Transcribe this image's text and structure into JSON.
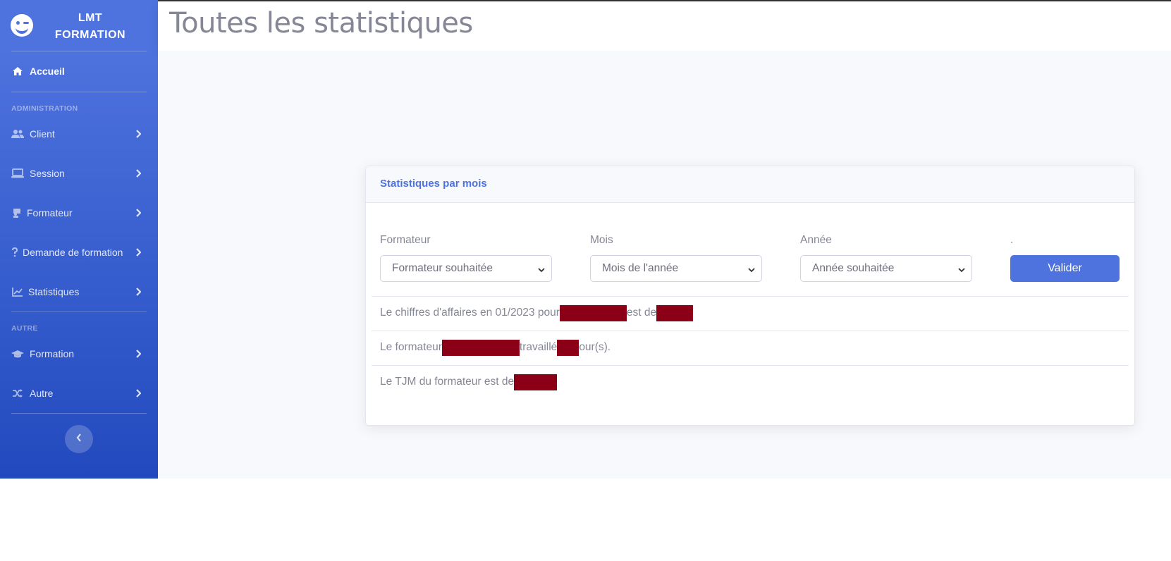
{
  "brand": {
    "line1": "LMT",
    "line2": "FORMATION",
    "logo_icon": "wink-smile-icon"
  },
  "sidebar": {
    "home": {
      "label": "Accueil",
      "icon": "home-icon"
    },
    "section_admin": "ADMINISTRATION",
    "admin_items": [
      {
        "label": "Client",
        "icon": "users-icon"
      },
      {
        "label": "Session",
        "icon": "laptop-icon"
      },
      {
        "label": "Formateur",
        "icon": "chalkboard-teacher-icon"
      },
      {
        "label": "Demande de formation",
        "icon": "question-icon"
      },
      {
        "label": "Statistiques",
        "icon": "chart-line-icon"
      }
    ],
    "section_other": "AUTRE",
    "other_items": [
      {
        "label": "Formation",
        "icon": "graduation-cap-icon"
      },
      {
        "label": "Autre",
        "icon": "random-icon"
      }
    ],
    "toggle_icon": "chevron-left-icon"
  },
  "header": {
    "title": "Toutes les statistiques"
  },
  "card": {
    "title": "Statistiques par mois",
    "fields": {
      "formateur_label": "Formateur",
      "formateur_value": "Formateur souhaitée",
      "mois_label": "Mois",
      "mois_value": "Mois de l'année",
      "annee_label": "Année",
      "annee_value": "Année souhaitée",
      "submit_label": ".",
      "submit_button": "Valider"
    },
    "stats": {
      "line1_part1": "Le chiffres d'affaires en 01/2023 pour",
      "line1_part2": "est de",
      "line2_part1": "Le formateur",
      "line2_part2": "travaillé",
      "line2_part3": "our(s).",
      "line3_part1": "Le TJM du formateur est de"
    }
  },
  "colors": {
    "primary": "#4e73df",
    "redaction": "#8b0016",
    "text_muted": "#858796"
  }
}
